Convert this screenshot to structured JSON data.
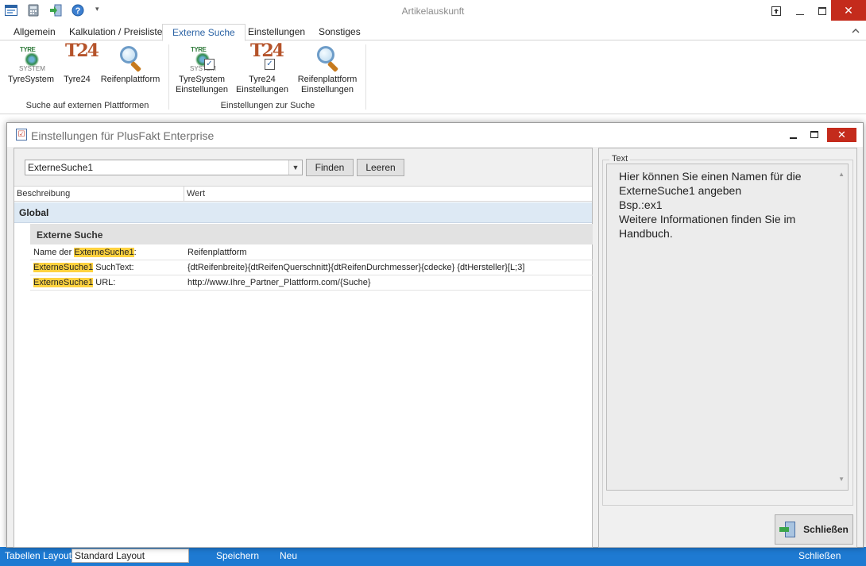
{
  "window": {
    "title": "Artikelauskunft"
  },
  "ribbon": {
    "tabs": [
      {
        "label": "Allgemein",
        "active": false
      },
      {
        "label": "Kalkulation / Preisliste",
        "active": false
      },
      {
        "label": "Externe Suche",
        "active": true
      },
      {
        "label": "Einstellungen",
        "active": false
      },
      {
        "label": "Sonstiges",
        "active": false
      }
    ],
    "groups": [
      {
        "label": "Suche auf externen Plattformen",
        "buttons": [
          {
            "label": "TyreSystem",
            "icon": "tyresystem-icon"
          },
          {
            "label": "Tyre24",
            "icon": "tyre24-icon"
          },
          {
            "label": "Reifenplattform",
            "icon": "magnifier-icon"
          }
        ]
      },
      {
        "label": "Einstellungen zur Suche",
        "buttons": [
          {
            "label_line1": "TyreSystem",
            "label_line2": "Einstellungen",
            "icon": "tyresystem-settings-icon"
          },
          {
            "label_line1": "Tyre24",
            "label_line2": "Einstellungen",
            "icon": "tyre24-settings-icon"
          },
          {
            "label_line1": "Reifenplattform",
            "label_line2": "Einstellungen",
            "icon": "magnifier-settings-icon"
          }
        ]
      }
    ],
    "icon_text": {
      "tyre_brand": "TYRE",
      "tyre_sub": "SYSTEM",
      "t24_brand": "T24"
    }
  },
  "statusbar": {
    "layout_label": "Tabellen Layout:",
    "layout_value": "Standard Layout",
    "save_label": "Speichern",
    "new_label": "Neu",
    "close_label": "Schließen"
  },
  "dialog": {
    "title": "Einstellungen für PlusFakt Enterprise",
    "search": {
      "value": "ExterneSuche1",
      "find_label": "Finden",
      "clear_label": "Leeren"
    },
    "grid": {
      "columns": [
        "Beschreibung",
        "Wert"
      ],
      "group": "Global",
      "subgroup": "Externe Suche",
      "rows": [
        {
          "desc_prefix": "Name der ",
          "desc_highlight": "ExterneSuche1",
          "desc_suffix": ":",
          "value": "Reifenplattform"
        },
        {
          "desc_prefix": "",
          "desc_highlight": "ExterneSuche1",
          "desc_suffix": " SuchText:",
          "value": "{dtReifenbreite}{dtReifenQuerschnitt}{dtReifenDurchmesser}{cdecke} {dtHersteller}[L;3]"
        },
        {
          "desc_prefix": "",
          "desc_highlight": "ExterneSuche1",
          "desc_suffix": " URL:",
          "value": "http://www.Ihre_Partner_Plattform.com/{Suche}"
        }
      ]
    },
    "text_panel": {
      "legend": "Text",
      "lines": [
        "Hier können Sie einen Namen für die",
        "ExterneSuche1 angeben",
        "Bsp.:ex1",
        "Weitere Informationen finden Sie im",
        "Handbuch."
      ]
    },
    "close_button": "Schließen"
  },
  "colors": {
    "accent": "#2b63a5",
    "close_red": "#c42b1c",
    "highlight": "#ffd23f",
    "statusbar": "#1e7ad2",
    "group_row": "#dde9f4"
  }
}
